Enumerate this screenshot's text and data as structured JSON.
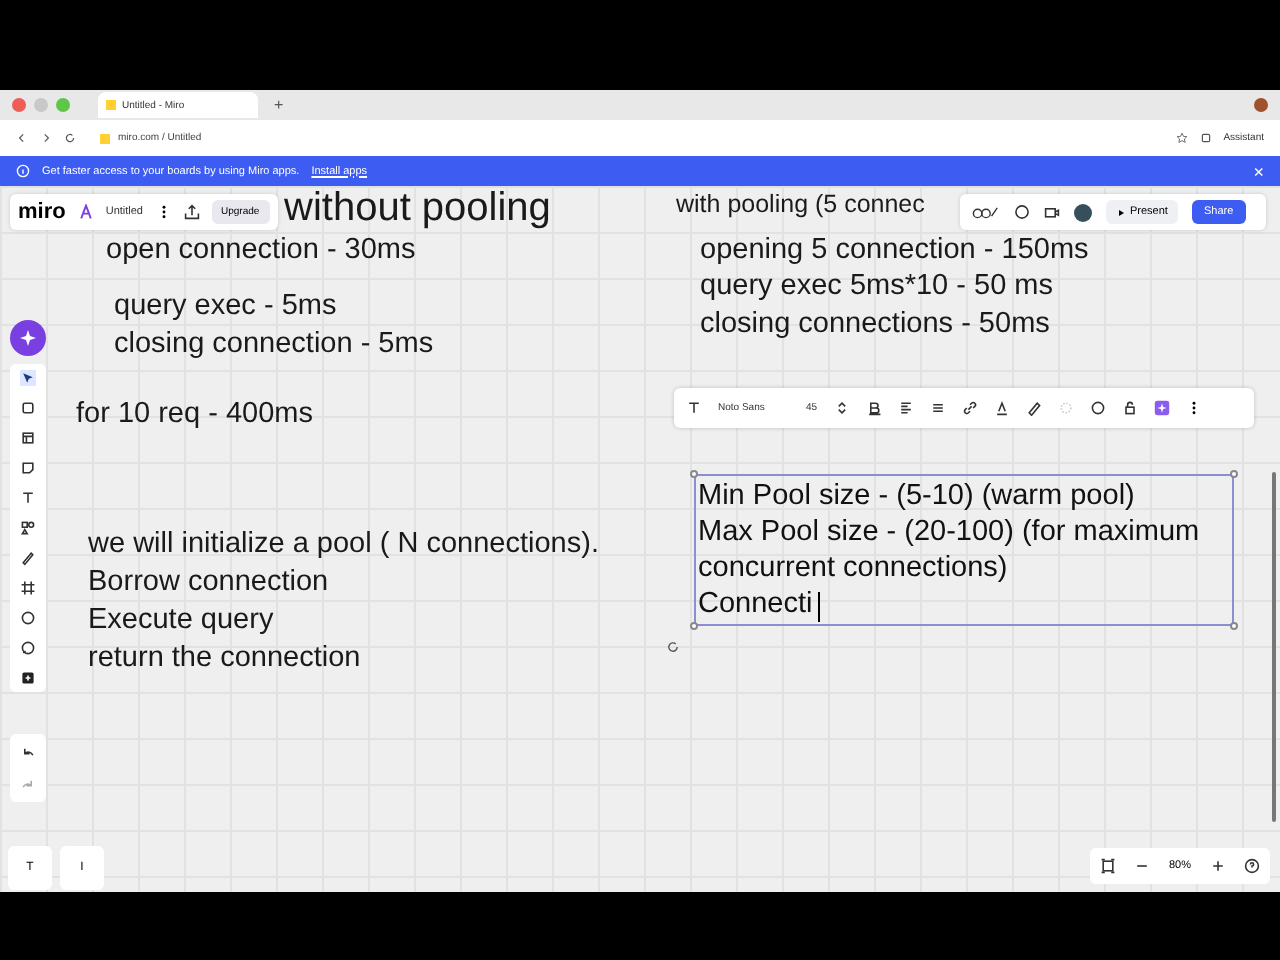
{
  "browser": {
    "tab_title": "Untitled - Miro",
    "new_tab": "+",
    "address": "miro.com / Untitled",
    "assistant": "Assistant"
  },
  "banner": {
    "message": "Get faster access to your boards by using Miro apps.",
    "link": "Install apps",
    "close": "×"
  },
  "board_bar": {
    "logo": "miro",
    "board_name": "Untitled",
    "upgrade": "Upgrade"
  },
  "top_actions": {
    "present": "Present",
    "share": "Share"
  },
  "canvas_texts": [
    {
      "text": "without pooling",
      "kind": "heading"
    },
    {
      "text": "open connection - 30ms",
      "kind": "note"
    },
    {
      "text": "query exec - 5ms",
      "kind": "note"
    },
    {
      "text": "closing connection - 5ms",
      "kind": "note"
    },
    {
      "text": "for 10 req - 400ms",
      "kind": "note"
    },
    {
      "text": "we will initialize a pool ( N connections).",
      "kind": "note"
    },
    {
      "text": "Borrow connection",
      "kind": "note"
    },
    {
      "text": "Execute query",
      "kind": "note"
    },
    {
      "text": "return the connection",
      "kind": "note"
    },
    {
      "text": "with pooling (5 connec",
      "kind": "subheading"
    },
    {
      "text": "opening 5 connection - 150ms",
      "kind": "note"
    },
    {
      "text": "query exec 5ms*10 - 50 ms",
      "kind": "note"
    },
    {
      "text": "closing connections - 50ms",
      "kind": "note"
    }
  ],
  "text_toolbar": {
    "font": "Noto Sans",
    "size": "45"
  },
  "selected_text": {
    "lines": [
      "Min Pool size - (5-10) (warm pool)",
      "Max Pool size - (20-100) (for maximum",
      "concurrent connections)",
      "Connecti"
    ]
  },
  "bottom_left": [
    "T",
    "I"
  ],
  "zoom": {
    "level_text": "80%"
  }
}
